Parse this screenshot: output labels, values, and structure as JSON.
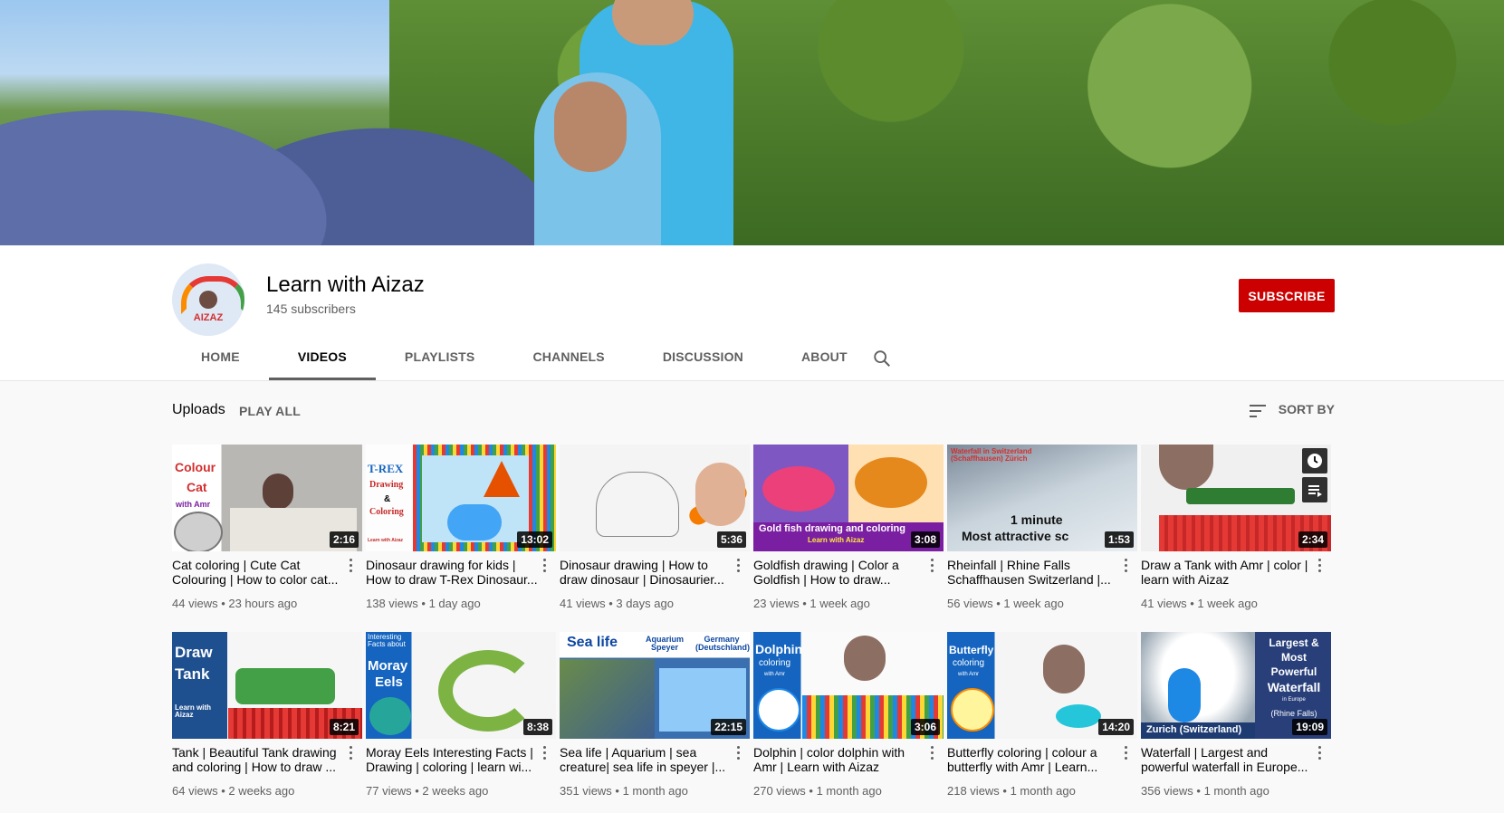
{
  "channel": {
    "title": "Learn with Aizaz",
    "subscribers": "145 subscribers",
    "avatar_text": "AIZAZ",
    "subscribe_label": "SUBSCRIBE"
  },
  "tabs": [
    {
      "label": "HOME",
      "active": false
    },
    {
      "label": "VIDEOS",
      "active": true
    },
    {
      "label": "PLAYLISTS",
      "active": false
    },
    {
      "label": "CHANNELS",
      "active": false
    },
    {
      "label": "DISCUSSION",
      "active": false
    },
    {
      "label": "ABOUT",
      "active": false
    }
  ],
  "uploads": {
    "label": "Uploads",
    "play_all": "PLAY ALL",
    "sort_by": "SORT BY"
  },
  "colors": {
    "accent_red": "#cc0000",
    "text_primary": "#030303",
    "text_secondary": "#606060"
  },
  "videos": [
    {
      "title": "Cat coloring | Cute Cat Colouring | How to color cat...",
      "duration": "2:16",
      "views": "44 views",
      "age": "23 hours ago",
      "thumb_text": [
        "Colour",
        "Cat",
        "with Amr"
      ]
    },
    {
      "title": "Dinosaur drawing for kids | How to draw T-Rex Dinosaur...",
      "duration": "13:02",
      "views": "138 views",
      "age": "1 day ago",
      "thumb_text": [
        "T-REX",
        "Drawing",
        "&",
        "Coloring",
        "Learn with Aizaz"
      ]
    },
    {
      "title": "Dinosaur drawing | How to draw dinosaur | Dinosaurier...",
      "duration": "5:36",
      "views": "41 views",
      "age": "3 days ago",
      "thumb_text": []
    },
    {
      "title": "Goldfish drawing | Color a Goldfish | How to draw...",
      "duration": "3:08",
      "views": "23 views",
      "age": "1 week ago",
      "thumb_text": [
        "Gold fish drawing and coloring",
        "Learn with Aizaz"
      ]
    },
    {
      "title": "Rheinfall | Rhine Falls Schaffhausen Switzerland |...",
      "duration": "1:53",
      "views": "56 views",
      "age": "1 week ago",
      "thumb_text": [
        "Waterfall in Switzerland (Schaffhausen) Zürich",
        "1 minute",
        "Most attractive sc"
      ]
    },
    {
      "title": "Draw a Tank with Amr | color | learn with Aizaz",
      "duration": "2:34",
      "views": "41 views",
      "age": "1 week ago",
      "thumb_text": []
    },
    {
      "title": "Tank | Beautiful Tank drawing and coloring | How to draw ...",
      "duration": "8:21",
      "views": "64 views",
      "age": "2 weeks ago",
      "thumb_text": [
        "Draw",
        "Tank",
        "Learn with Aizaz"
      ]
    },
    {
      "title": "Moray Eels Interesting Facts | Drawing | coloring | learn wi...",
      "duration": "8:38",
      "views": "77 views",
      "age": "2 weeks ago",
      "thumb_text": [
        "Interesting Facts about",
        "Moray",
        "Eels"
      ]
    },
    {
      "title": "Sea life | Aquarium | sea creature| sea life in speyer |...",
      "duration": "22:15",
      "views": "351 views",
      "age": "1 month ago",
      "thumb_text": [
        "Sea life",
        "Aquarium Speyer",
        "Germany (Deutschland)"
      ]
    },
    {
      "title": "Dolphin | color dolphin with Amr | Learn with Aizaz",
      "duration": "3:06",
      "views": "270 views",
      "age": "1 month ago",
      "thumb_text": [
        "Dolphin",
        "coloring",
        "with Amr"
      ]
    },
    {
      "title": "Butterfly coloring | colour a butterfly with Amr | Learn...",
      "duration": "14:20",
      "views": "218 views",
      "age": "1 month ago",
      "thumb_text": [
        "Butterfly",
        "coloring",
        "with Amr"
      ]
    },
    {
      "title": "Waterfall | Largest and powerful waterfall in Europe...",
      "duration": "19:09",
      "views": "356 views",
      "age": "1 month ago",
      "thumb_text": [
        "Largest &",
        "Most",
        "Powerful",
        "Waterfall",
        "in Europe",
        "(Rhine Falls)",
        "Zurich (Switzerland)"
      ]
    }
  ]
}
